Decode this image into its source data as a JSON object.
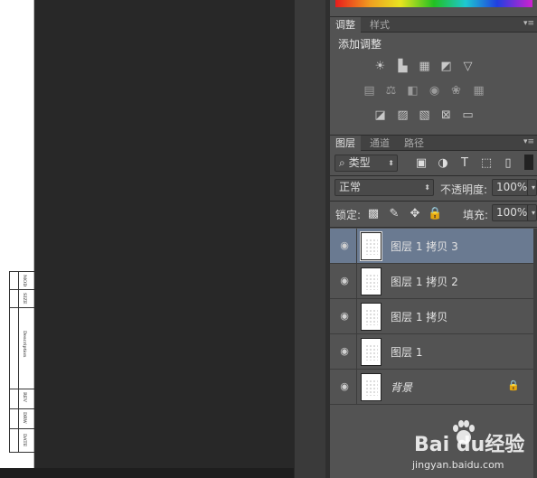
{
  "adjustments_panel": {
    "tabs": [
      "调整",
      "样式"
    ],
    "title": "添加调整",
    "icon_rows": [
      [
        "brightness-contrast-icon",
        "levels-icon",
        "curves-icon",
        "exposure-icon",
        "vibrance-icon"
      ],
      [
        "hue-saturation-icon",
        "color-balance-icon",
        "black-white-icon",
        "photo-filter-icon",
        "channel-mixer-icon",
        "color-lookup-icon"
      ],
      [
        "invert-icon",
        "posterize-icon",
        "threshold-icon",
        "selective-color-icon",
        "gradient-map-icon"
      ]
    ]
  },
  "layers_panel": {
    "tabs": [
      "图层",
      "通道",
      "路径"
    ],
    "filter_kind": "类型",
    "blend_mode": "正常",
    "opacity_label": "不透明度:",
    "opacity_value": "100%",
    "lock_label": "锁定:",
    "fill_label": "填充:",
    "fill_value": "100%",
    "layers": [
      {
        "name": "图层 1 拷贝 3",
        "selected": true
      },
      {
        "name": "图层 1 拷贝 2",
        "selected": false
      },
      {
        "name": "图层 1 拷贝",
        "selected": false
      },
      {
        "name": "图层 1",
        "selected": false
      },
      {
        "name": "背景",
        "selected": false,
        "locked": true
      }
    ]
  },
  "document": {
    "title_block": [
      "MOD",
      "SIZE",
      "Description",
      "REV",
      "DRW",
      "DATE"
    ]
  },
  "watermark": {
    "brand": "Bai du经验",
    "url": "jingyan.baidu.com"
  }
}
